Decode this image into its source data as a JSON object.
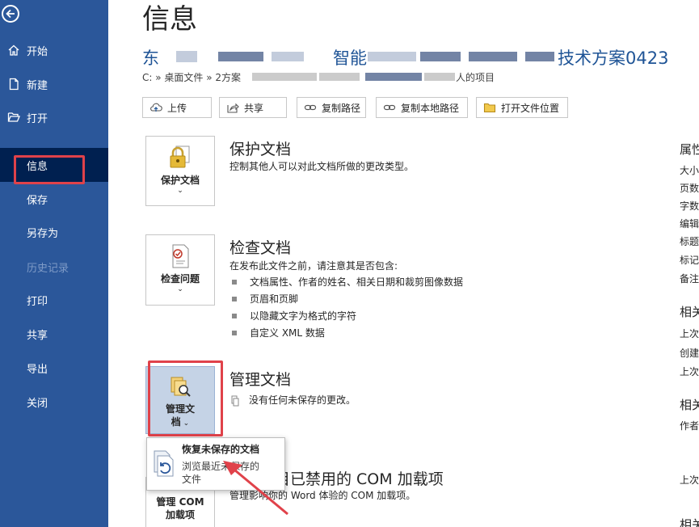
{
  "sidebar": {
    "items": [
      {
        "label": "开始",
        "icon": "home-icon"
      },
      {
        "label": "新建",
        "icon": "new-document-icon"
      },
      {
        "label": "打开",
        "icon": "folder-open-icon"
      },
      {
        "label": "信息",
        "selected": true
      },
      {
        "label": "保存"
      },
      {
        "label": "另存为"
      },
      {
        "label": "历史记录",
        "disabled": true
      },
      {
        "label": "打印"
      },
      {
        "label": "共享"
      },
      {
        "label": "导出"
      },
      {
        "label": "关闭"
      }
    ]
  },
  "main": {
    "page_title": "信息",
    "doc_title_visible_start": "东",
    "doc_title_visible_mid": "智能",
    "doc_title_visible_end": "技术方案0423",
    "doc_path_start": "C: » 桌面文件 » 2方案",
    "doc_path_end": "人的项目",
    "actions": [
      {
        "label": "上传",
        "icon": "upload-icon"
      },
      {
        "label": "共享",
        "icon": "share-icon"
      },
      {
        "label": "复制路径",
        "icon": "link-icon"
      },
      {
        "label": "复制本地路径",
        "icon": "link-icon"
      },
      {
        "label": "打开文件位置",
        "icon": "folder-icon"
      }
    ],
    "protect": {
      "button_label": "保护文档",
      "title": "保护文档",
      "description": "控制其他人可以对此文档所做的更改类型。"
    },
    "inspect": {
      "button_label": "检查问题",
      "title": "检查文档",
      "description": "在发布此文件之前，请注意其是否包含:",
      "bullets": [
        "文档属性、作者的姓名、相关日期和裁剪图像数据",
        "页眉和页脚",
        "以隐藏文字为格式的字符",
        "自定义 XML 数据"
      ]
    },
    "manage": {
      "button_label_line1": "管理文",
      "button_label_line2": "档",
      "title": "管理文档",
      "description": "没有任何未保存的更改。"
    },
    "com": {
      "button_label_line1": "管理 COM",
      "button_label_line2": "加载项",
      "title_visible": "目已禁用的 COM 加载项",
      "description_visible": "管理影响你的 Word 体验的 COM 加载项。"
    },
    "popup": {
      "title": "恢复未保存的文档",
      "description_line1": "浏览最近未保存的",
      "description_line2": "文件"
    }
  },
  "properties": {
    "heading": "属性",
    "items": [
      "大小",
      "页数",
      "字数",
      "编辑",
      "标题",
      "标记",
      "备注"
    ],
    "related_dates_heading": "相关",
    "dates": [
      "上次",
      "创建",
      "上次"
    ],
    "related_people_heading": "相关",
    "people": [
      "作者"
    ],
    "last_item": "上次",
    "bottom_heading": "相关"
  }
}
